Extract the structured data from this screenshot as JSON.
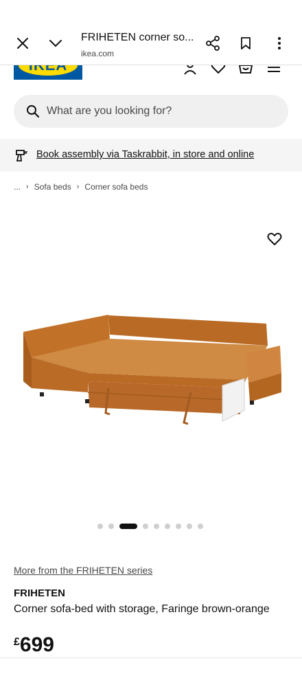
{
  "browser": {
    "title": "FRIHETEN corner so...",
    "url": "ikea.com",
    "icons": [
      "close-icon",
      "chevron-down-icon",
      "share-icon",
      "bookmark-icon",
      "more-vertical-icon"
    ]
  },
  "header": {
    "logo_text": "IKEA",
    "icons": [
      "account-icon",
      "heart-icon",
      "basket-icon",
      "menu-icon"
    ]
  },
  "search": {
    "placeholder": "What are you looking for?"
  },
  "banner": {
    "link_text": "Book assembly via Taskrabbit, in store and online"
  },
  "breadcrumb": {
    "ellipsis": "...",
    "items": [
      "Sofa beds",
      "Corner sofa beds"
    ]
  },
  "gallery": {
    "dot_count": 9,
    "active_index": 2
  },
  "product": {
    "series_link": "More from the FRIHETEN series",
    "name": "FRIHETEN",
    "description": "Corner sofa-bed with storage, Faringe brown-orange",
    "currency": "£",
    "price": "699"
  },
  "colors": {
    "ikea_blue": "#0058a3",
    "ikea_yellow": "#ffdb00",
    "sofa": "#c8782f"
  }
}
